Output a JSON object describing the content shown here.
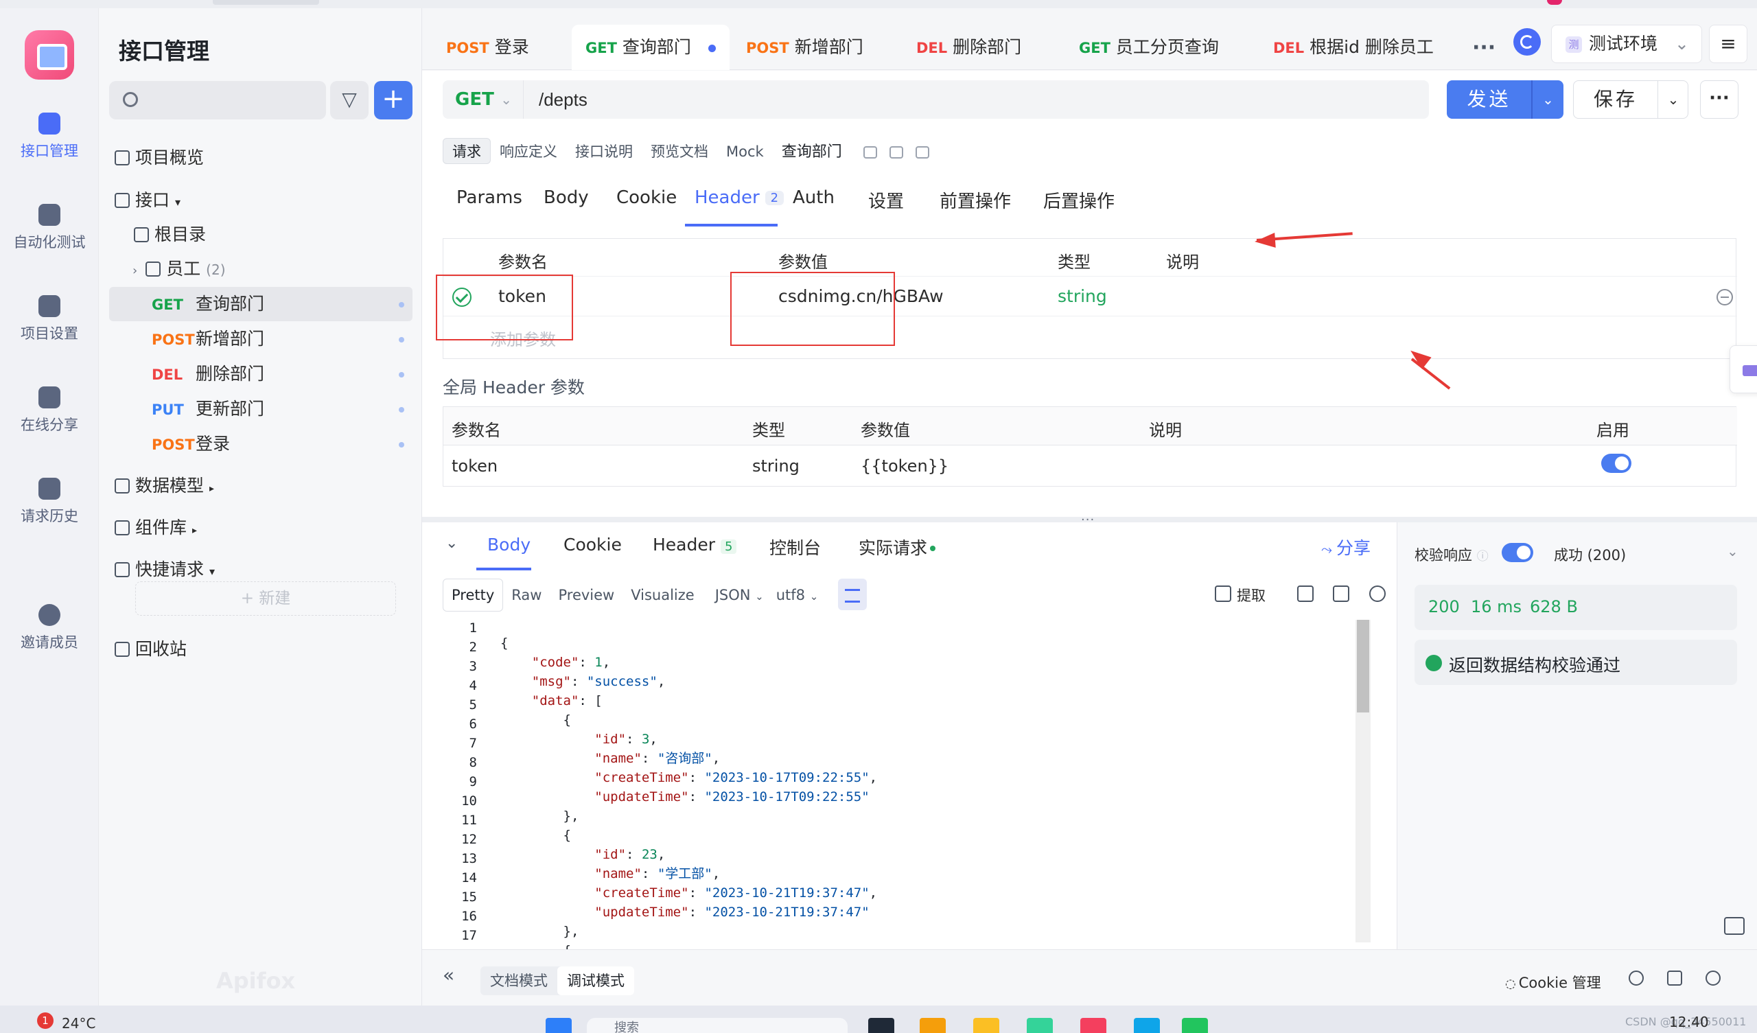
{
  "rail": {
    "items": [
      {
        "label": "接口管理"
      },
      {
        "label": "自动化测试"
      },
      {
        "label": "项目设置"
      },
      {
        "label": "在线分享"
      },
      {
        "label": "请求历史"
      },
      {
        "label": "邀请成员"
      }
    ]
  },
  "sidebar": {
    "title": "接口管理",
    "search_placeholder": "",
    "overview": "项目概览",
    "api_root": "接口",
    "root_dir": "根目录",
    "folder": {
      "name": "员工",
      "count": "(2)"
    },
    "endpoints": [
      {
        "method": "GET",
        "name": "查询部门"
      },
      {
        "method": "POST",
        "name": "新增部门"
      },
      {
        "method": "DEL",
        "name": "删除部门"
      },
      {
        "method": "PUT",
        "name": "更新部门"
      },
      {
        "method": "POST",
        "name": "登录"
      }
    ],
    "data_models": "数据模型",
    "components": "组件库",
    "quick_request": "快捷请求",
    "new_label": "+ 新建",
    "recycle": "回收站",
    "watermark": "Apifox"
  },
  "tabs": [
    {
      "method": "POST",
      "name": "登录"
    },
    {
      "method": "GET",
      "name": "查询部门"
    },
    {
      "method": "POST",
      "name": "新增部门"
    },
    {
      "method": "DEL",
      "name": "删除部门"
    },
    {
      "method": "GET",
      "name": "员工分页查询"
    },
    {
      "method": "DEL",
      "name": "根据id 删除员工"
    }
  ],
  "toolbar": {
    "more": "···",
    "env_badge": "测",
    "env_label": "测试环境"
  },
  "request": {
    "method": "GET",
    "url": "/depts",
    "send": "发送",
    "save": "保存",
    "more": "···",
    "subtabs": [
      "请求",
      "响应定义",
      "接口说明",
      "预览文档",
      "Mock"
    ],
    "name": "查询部门",
    "param_tabs": [
      "Params",
      "Body",
      "Cookie",
      "Header",
      "Auth",
      "设置",
      "前置操作",
      "后置操作"
    ],
    "header_badge": "2",
    "table_headers": {
      "name": "参数名",
      "value": "参数值",
      "type": "类型",
      "desc": "说明"
    },
    "header_row": {
      "name": "token",
      "value": "csdnimg.cn/hGBAw",
      "type": "string",
      "desc": ""
    },
    "add_param": "添加参数",
    "global_title": "全局 Header 参数",
    "global_headers": {
      "name": "参数名",
      "type": "类型",
      "value": "参数值",
      "desc": "说明",
      "enabled": "启用"
    },
    "global_row": {
      "name": "token",
      "type": "string",
      "value": "{{token}}",
      "desc": "",
      "enabled": true
    }
  },
  "response": {
    "tabs": [
      "Body",
      "Cookie",
      "Header",
      "控制台",
      "实际请求"
    ],
    "header_badge": "5",
    "share": "分享",
    "view_tabs": [
      "Pretty",
      "Raw",
      "Preview",
      "Visualize"
    ],
    "format": "JSON",
    "encoding": "utf8",
    "extract": "提取",
    "line_numbers": [
      "1",
      "2",
      "3",
      "4",
      "5",
      "6",
      "7",
      "8",
      "9",
      "10",
      "11",
      "12",
      "13",
      "14",
      "15",
      "16",
      "17"
    ]
  },
  "validation": {
    "label": "校验响应",
    "status": "成功 (200)",
    "code": "200",
    "time": "16 ms",
    "size": "628 B",
    "message": "返回数据结构校验通过"
  },
  "bottom": {
    "doc_mode": "文档模式",
    "debug_mode": "调试模式",
    "cookie_manage": "Cookie 管理"
  },
  "taskbar": {
    "badge": "1",
    "temp": "24°C",
    "search": "搜索",
    "time": "12:40",
    "csdn": "CSDN @qq_34550011"
  },
  "colors": {
    "accent": "#4a7cf0",
    "get": "#16a34a",
    "post": "#f97316",
    "del": "#ef4444",
    "put": "#3b82f6",
    "annotation": "#e53935"
  }
}
